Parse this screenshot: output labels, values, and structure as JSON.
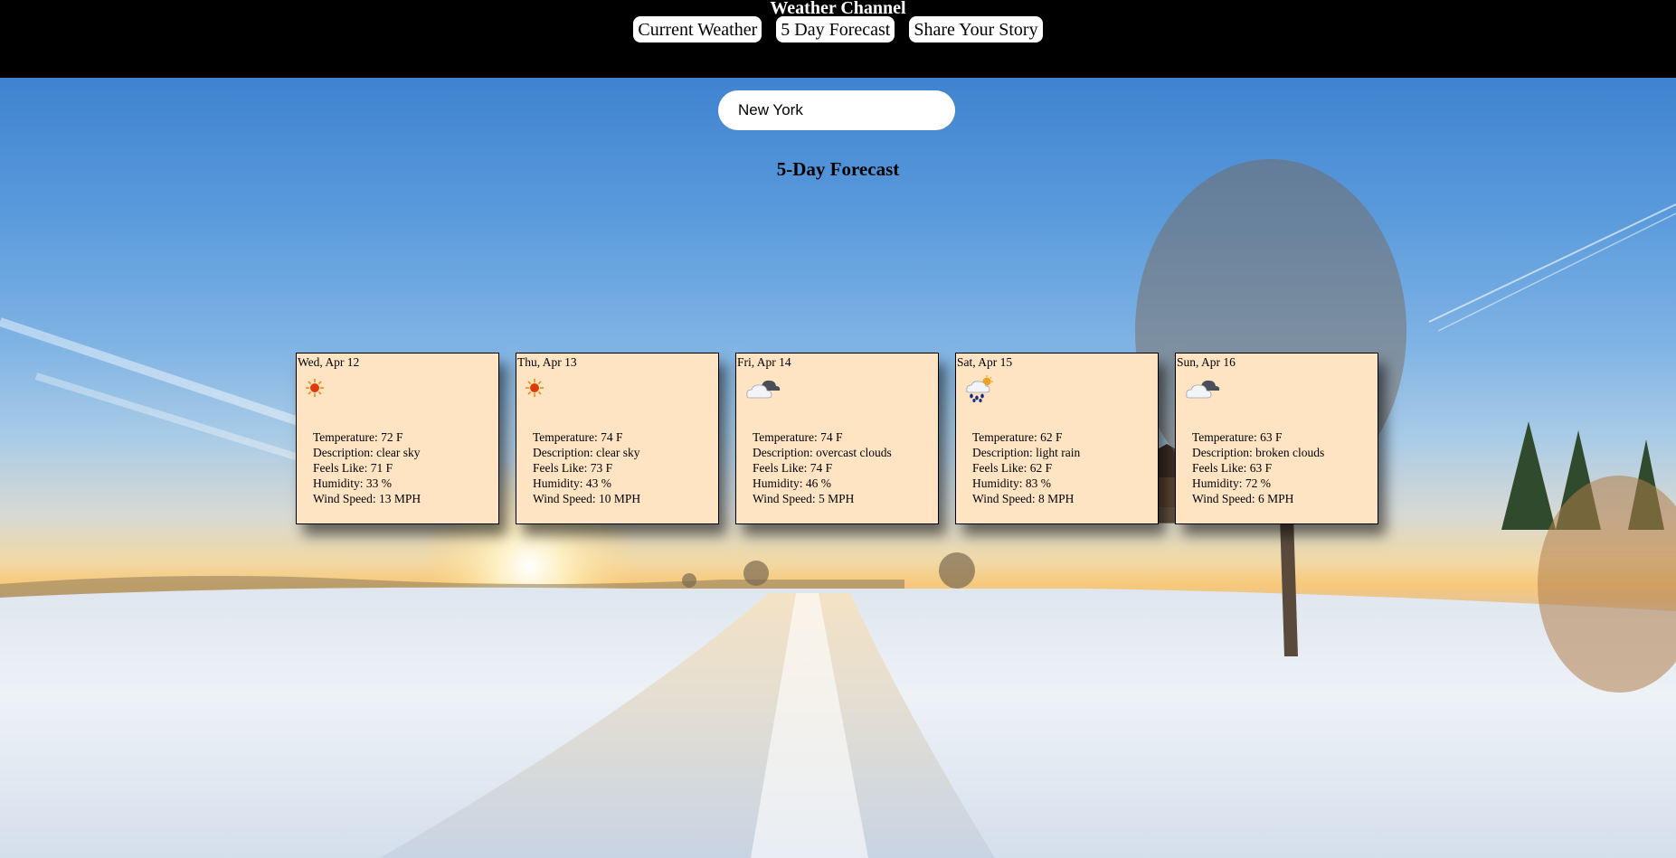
{
  "header": {
    "title": "Weather Channel",
    "nav": [
      {
        "label": "Current Weather"
      },
      {
        "label": "5 Day Forecast"
      },
      {
        "label": "Share Your Story"
      }
    ]
  },
  "search": {
    "value": "New York"
  },
  "main": {
    "heading": "5-Day Forecast",
    "forecast": [
      {
        "date": "Wed, Apr 12",
        "icon": "sun-icon",
        "temperature": "Temperature: 72 F",
        "description": "Description: clear sky",
        "feels_like": "Feels Like: 71 F",
        "humidity": "Humidity: 33 %",
        "wind": "Wind Speed: 13 MPH"
      },
      {
        "date": "Thu, Apr 13",
        "icon": "sun-icon",
        "temperature": "Temperature: 74 F",
        "description": "Description: clear sky",
        "feels_like": "Feels Like: 73 F",
        "humidity": "Humidity: 43 %",
        "wind": "Wind Speed: 10 MPH"
      },
      {
        "date": "Fri, Apr 14",
        "icon": "overcast-clouds-icon",
        "temperature": "Temperature: 74 F",
        "description": "Description: overcast clouds",
        "feels_like": "Feels Like: 74 F",
        "humidity": "Humidity: 46 %",
        "wind": "Wind Speed: 5 MPH"
      },
      {
        "date": "Sat, Apr 15",
        "icon": "rain-cloud-sun-icon",
        "temperature": "Temperature: 62 F",
        "description": "Description: light rain",
        "feels_like": "Feels Like: 62 F",
        "humidity": "Humidity: 83 %",
        "wind": "Wind Speed: 8 MPH"
      },
      {
        "date": "Sun, Apr 16",
        "icon": "broken-clouds-icon",
        "temperature": "Temperature: 63 F",
        "description": "Description: broken clouds",
        "feels_like": "Feels Like: 63 F",
        "humidity": "Humidity: 72 %",
        "wind": "Wind Speed: 6 MPH"
      }
    ]
  },
  "colors": {
    "header_bg": "#000000",
    "card_bg": "#ffe4c4",
    "sun": "#e03a0a"
  }
}
